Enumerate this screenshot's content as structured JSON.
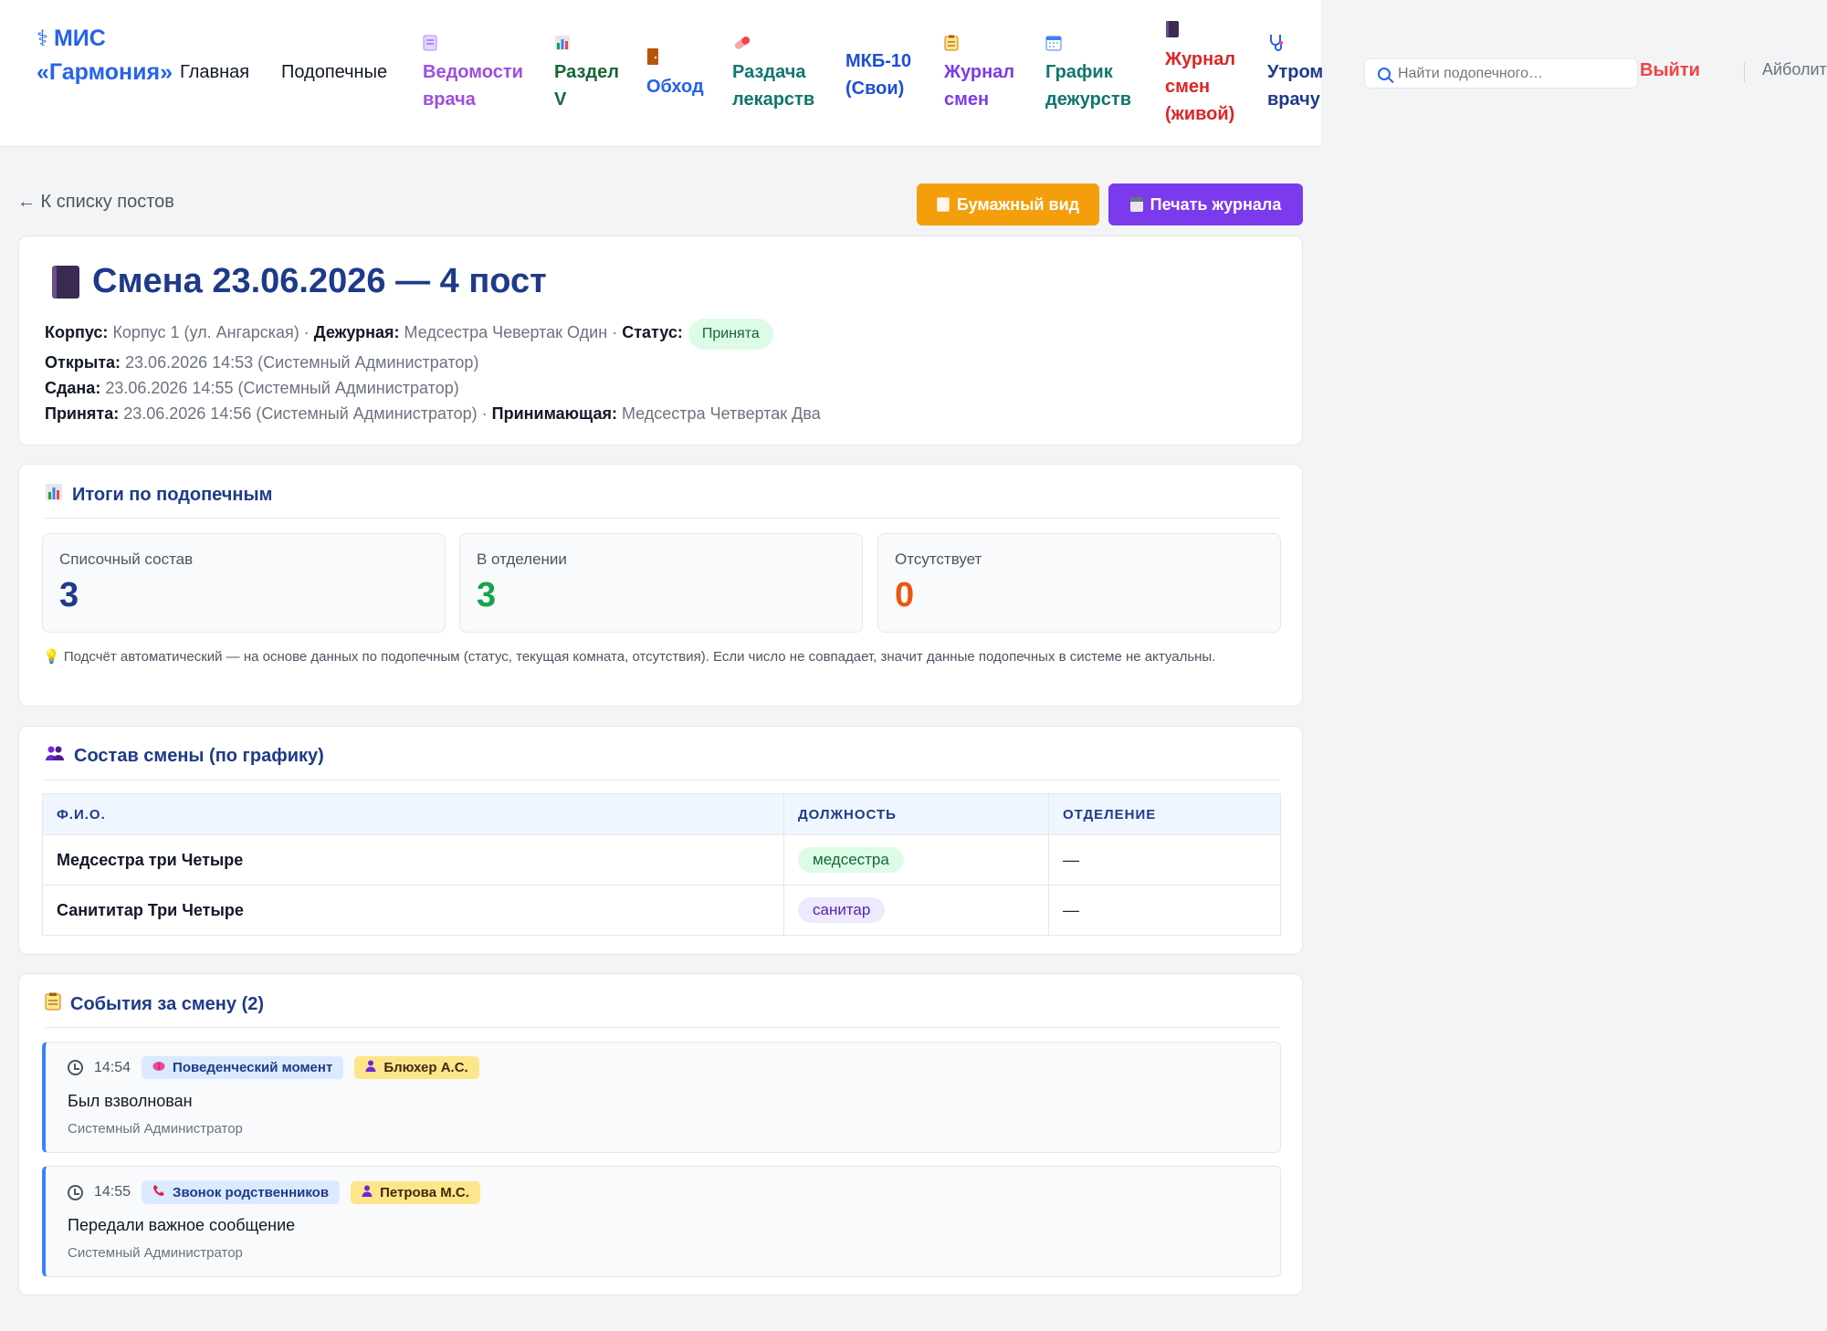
{
  "app": {
    "logo_line1": "МИС",
    "logo_line2": "«Гармония»"
  },
  "nav": [
    {
      "label": "Главная",
      "color": "#111827",
      "icon": ""
    },
    {
      "label": "Подопечные",
      "color": "#111827",
      "icon": ""
    },
    {
      "label_l1": "Ведомости",
      "label_l2": "врача",
      "color": "#9d4edd",
      "icon": "document-icon"
    },
    {
      "label_l1": "Раздел",
      "label_l2": "V",
      "color": "#166534",
      "icon": "bar-chart-icon"
    },
    {
      "label": "Обход",
      "color": "#2563eb",
      "icon": "door-icon"
    },
    {
      "label_l1": "Раздача",
      "label_l2": "лекарств",
      "color": "#0f766e",
      "icon": "pill-icon"
    },
    {
      "label_l1": "МКБ-10",
      "label_l2": "(Свои)",
      "color": "#1d4ed8",
      "icon": ""
    },
    {
      "label_l1": "Журнал",
      "label_l2": "смен",
      "color": "#7c3aed",
      "icon": "clipboard-icon"
    },
    {
      "label_l1": "График",
      "label_l2": "дежурств",
      "color": "#0f766e",
      "icon": "calendar-icon"
    },
    {
      "label_l1": "Журнал",
      "label_l2": "смен",
      "label_l3": "(живой)",
      "color": "#dc2626",
      "icon": "book-icon"
    },
    {
      "label_l1": "Утром",
      "label_l2": "врачу",
      "color": "#1e3a8a",
      "icon": "stethoscope-icon"
    }
  ],
  "search": {
    "placeholder": "Найти подопечного…"
  },
  "header": {
    "logout": "Выйти",
    "user": "Айболит"
  },
  "back_link": "← К списку постов",
  "buttons": {
    "paper": "Бумажный вид",
    "print": "Печать журнала"
  },
  "shift": {
    "title": "Смена 23.06.2026 — 4 пост",
    "korpus_label": "Корпус:",
    "korpus": "Корпус 1 (ул. Ангарская)",
    "duty_label": "Дежурная:",
    "duty": "Медсестра Чевертак Один",
    "status_label": "Статус:",
    "status": "Принята",
    "opened_label": "Открыта:",
    "opened": "23.06.2026 14:53 (Системный Администратор)",
    "handed_label": "Сдана:",
    "handed": "23.06.2026 14:55 (Системный Администратор)",
    "accepted_label": "Принята:",
    "accepted": "23.06.2026 14:56 (Системный Администратор)",
    "receiver_label": "Принимающая:",
    "receiver": "Медсестра Четвертак Два",
    "sep": "·"
  },
  "totals": {
    "title": "Итоги по подопечным",
    "stats": [
      {
        "label": "Списочный состав",
        "value": "3",
        "color": "#1e3a8a"
      },
      {
        "label": "В отделении",
        "value": "3",
        "color": "#16a34a"
      },
      {
        "label": "Отсутствует",
        "value": "0",
        "color": "#ea580c"
      }
    ],
    "note": "Подсчёт автоматический — на основе данных по подопечным (статус, текущая комната, отсутствия). Если число не совпадает, значит данные подопечных в системе не актуальны."
  },
  "staff": {
    "title": "Состав смены (по графику)",
    "columns": [
      "Ф.И.О.",
      "ДОЛЖНОСТЬ",
      "ОТДЕЛЕНИЕ"
    ],
    "rows": [
      {
        "name": "Медсестра три Четыре",
        "role": "медсестра",
        "role_bg": "#dcfce7",
        "role_fg": "#166534",
        "dept": "—"
      },
      {
        "name": "Санититар Три Четыре",
        "role": "санитар",
        "role_bg": "#ede9fe",
        "role_fg": "#5b21b6",
        "dept": "—"
      }
    ]
  },
  "events": {
    "title": "События за смену (2)",
    "items": [
      {
        "time": "14:54",
        "type": "Поведенческий момент",
        "type_icon": "brain-icon",
        "person": "Блюхер А.С.",
        "text": "Был взволнован",
        "author": "Системный Администратор"
      },
      {
        "time": "14:55",
        "type": "Звонок родственников",
        "type_icon": "phone-icon",
        "person": "Петрова М.С.",
        "text": "Передали важное сообщение",
        "author": "Системный Администратор"
      }
    ]
  }
}
